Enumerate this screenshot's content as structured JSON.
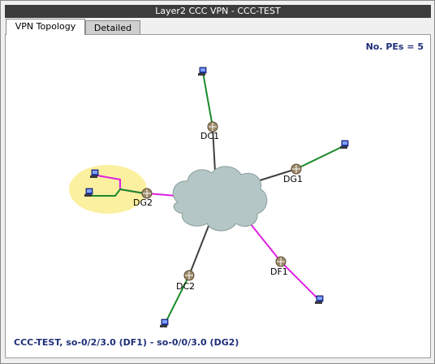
{
  "window": {
    "title": "Layer2 CCC VPN - CCC-TEST"
  },
  "tabs": [
    {
      "label": "VPN Topology",
      "active": true
    },
    {
      "label": "Detailed",
      "active": false
    }
  ],
  "summary": {
    "pe_count": "No. PEs = 5"
  },
  "status": {
    "text": "CCC-TEST, so-0/2/3.0 (DF1) - so-0/0/3.0 (DG2)"
  },
  "nodes": [
    {
      "id": "DC1",
      "label": "DC1",
      "icon": "router-icon"
    },
    {
      "id": "DG1",
      "label": "DG1",
      "icon": "router-icon"
    },
    {
      "id": "DG2",
      "label": "DG2",
      "icon": "router-icon"
    },
    {
      "id": "DF1",
      "label": "DF1",
      "icon": "router-icon"
    },
    {
      "id": "DC2",
      "label": "DC2",
      "icon": "router-icon"
    }
  ],
  "colors": {
    "cloud": "#b4c6c6",
    "highlight": "#fbf0a0",
    "core_link": "#404040",
    "access_link": "#1a8a2a",
    "selected_link": "#e020e0"
  }
}
